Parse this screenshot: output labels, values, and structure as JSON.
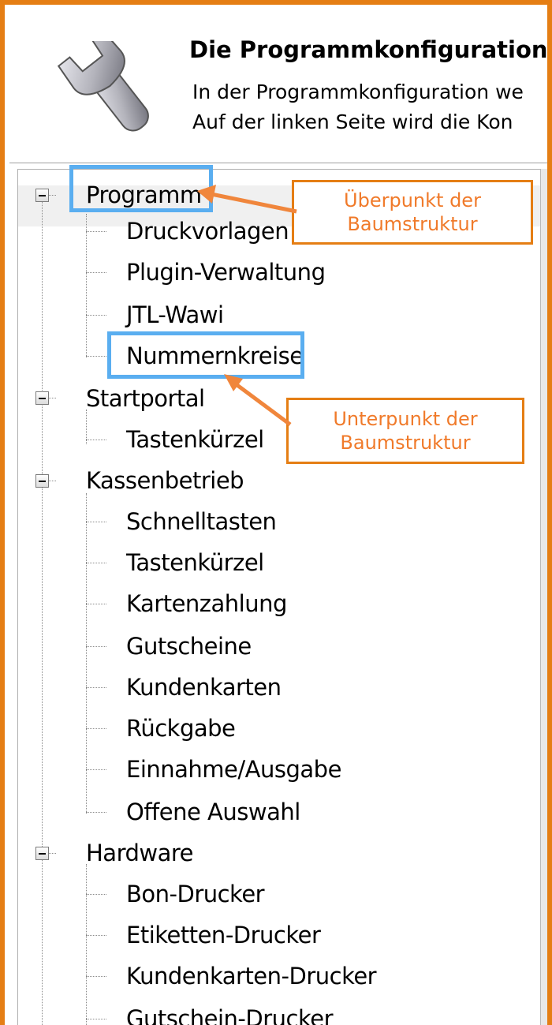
{
  "header": {
    "title": "Die Programmkonfiguration",
    "description_lines": [
      "In der Programmkonfiguration we",
      "Auf der linken Seite wird die Kon"
    ],
    "icon": "wrench-icon"
  },
  "tree": {
    "groups": [
      {
        "label": "Programm",
        "expanded": true,
        "children": [
          "Druckvorlagen",
          "Plugin-Verwaltung",
          "JTL-Wawi",
          "Nummernkreise"
        ]
      },
      {
        "label": "Startportal",
        "expanded": true,
        "children": [
          "Tastenkürzel"
        ]
      },
      {
        "label": "Kassenbetrieb",
        "expanded": true,
        "children": [
          "Schnelltasten",
          "Tastenkürzel",
          "Kartenzahlung",
          "Gutscheine",
          "Kundenkarten",
          "Rückgabe",
          "Einnahme/Ausgabe",
          "Offene Auswahl"
        ]
      },
      {
        "label": "Hardware",
        "expanded": true,
        "children": [
          "Bon-Drucker",
          "Etiketten-Drucker",
          "Kundenkarten-Drucker",
          "Gutschein-Drucker"
        ]
      }
    ]
  },
  "annotations": {
    "top": {
      "line1": "Überpunkt der",
      "line2": "Baumstruktur"
    },
    "bottom": {
      "line1": "Unterpunkt der",
      "line2": "Baumstruktur"
    }
  },
  "colors": {
    "frame": "#E57E14",
    "highlight": "#5AAEF0",
    "callout_text": "#F07A2A",
    "arrow": "#F0863C"
  }
}
